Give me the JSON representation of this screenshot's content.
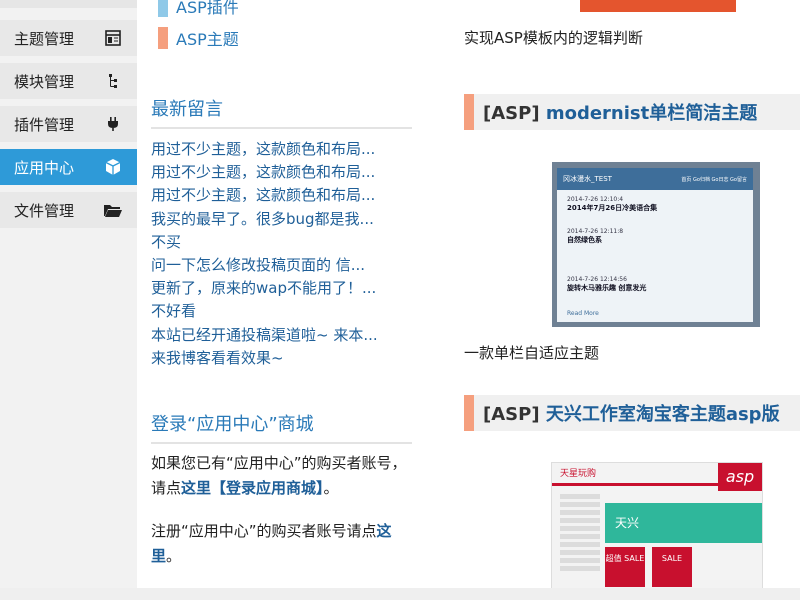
{
  "sidebar": {
    "items": [
      {
        "label": "主题管理",
        "icon": "layout-icon",
        "active": false
      },
      {
        "label": "模块管理",
        "icon": "sitemap-icon",
        "active": false
      },
      {
        "label": "插件管理",
        "icon": "plug-icon",
        "active": false
      },
      {
        "label": "应用中心",
        "icon": "cube-icon",
        "active": true
      },
      {
        "label": "文件管理",
        "icon": "folder-open-icon",
        "active": false
      }
    ]
  },
  "plugins": [
    {
      "label": "ASP插件",
      "color": "#8fc9e8"
    },
    {
      "label": "ASP主题",
      "color": "#f59f7e"
    }
  ],
  "latest_messages": {
    "title": "最新留言",
    "items": [
      "用过不少主题，这款颜色和布局...",
      "用过不少主题，这款颜色和布局...",
      "用过不少主题，这款颜色和布局...",
      "我买的最早了。很多bug都是我...",
      "不买",
      "问一下怎么修改投稿页面的 信...",
      "更新了，原来的wap不能用了！...",
      "不好看",
      "本站已经开通投稿渠道啦~ 来本...",
      "来我博客看看效果~"
    ]
  },
  "login": {
    "title": "登录“应用中心”商城",
    "line1_pre": "如果您已有“应用中心”的购买者账号，请点",
    "line1_link": "这里【登录应用商城】",
    "line1_post": "。",
    "line2_pre": "注册“应用中心”的购买者账号请点",
    "line2_link": "这里",
    "line2_post": "。"
  },
  "right": {
    "caption_top": "实现ASP模板内的逻辑判断",
    "topic1": {
      "tag": "[ASP]",
      "name": "modernist单栏简洁主题",
      "caption": "一款单栏自适应主题"
    },
    "topic2": {
      "tag": "[ASP]",
      "name": "天兴工作室淘宝客主题asp版"
    },
    "thumb1": {
      "site_name": "冈冰漫水_TEST",
      "nav": "首页 Go归档 Go日志 Go留言",
      "posts": [
        {
          "date": "2014-7-26 12:10:4",
          "title": "2014年7月26日冷美语合集"
        },
        {
          "date": "2014-7-26 12:11:8",
          "title": "自然绿色系"
        },
        {
          "date": "2014-7-26 12:14:56",
          "title": "旋转木马雅乐趣 创意发光"
        }
      ],
      "more": "Read More"
    },
    "thumb2": {
      "logo": "天星玩购",
      "badge": "asp",
      "banner": "天兴",
      "sale1": "超值 SALE",
      "sale2": "SALE"
    }
  },
  "colors": {
    "accent_blue": "#2e9ad8",
    "link_blue": "#1f5f98",
    "orange_bar": "#f59f7e",
    "light_blue_bar": "#8fc9e8"
  }
}
